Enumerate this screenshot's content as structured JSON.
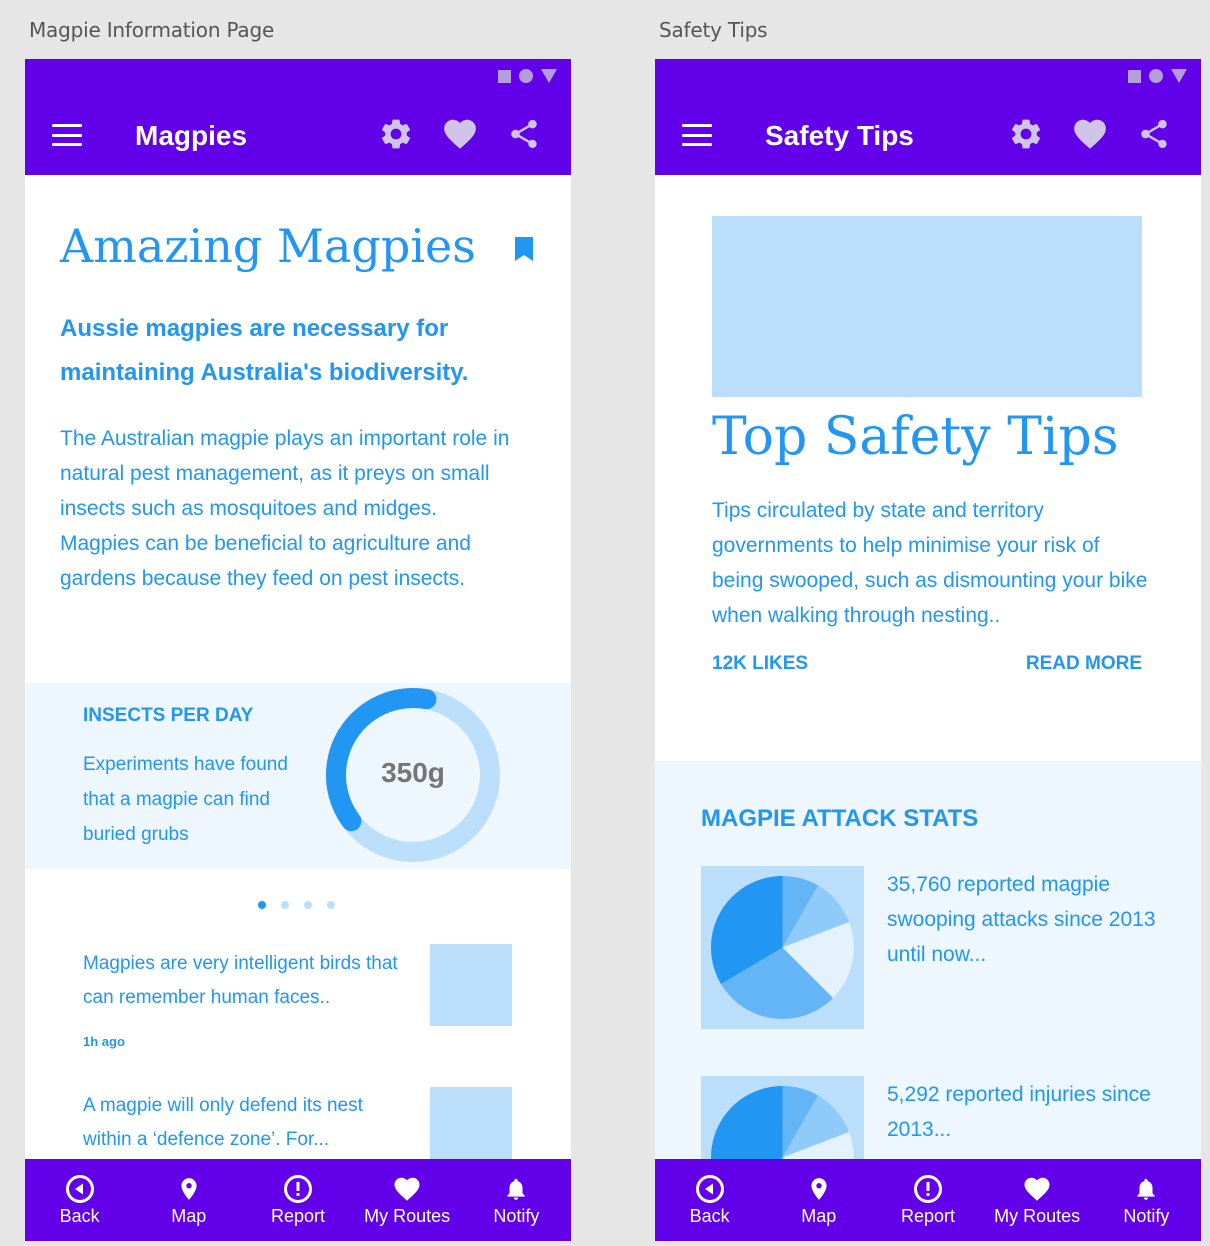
{
  "artboards": [
    {
      "label": "Magpie Information Page",
      "appbar": {
        "title": "Magpies"
      },
      "content": {
        "headline": "Amazing Magpies",
        "subhead": "Aussie magpies are necessary for maintaining Australia's biodiversity.",
        "body": "The Australian magpie plays an important role in natural pest management, as it preys on small insects such as mosquitoes and midges. Magpies can be beneficial to agriculture and gardens because they feed on pest insects.",
        "insects_panel": {
          "title": "INSECTS PER DAY",
          "text": "Experiments have found that a magpie can find buried grubs",
          "donut_value": "350g",
          "donut_fraction": 0.38
        },
        "carousel": {
          "total": 4,
          "active": 0
        },
        "news": [
          {
            "text": "Magpies are very intelligent birds that can remember human faces..",
            "time": "1h ago"
          },
          {
            "text": "A magpie will only defend its nest within a ‘defence zone’. For..."
          }
        ]
      }
    },
    {
      "label": "Safety Tips",
      "appbar": {
        "title": "Safety Tips"
      },
      "content": {
        "headline": "Top Safety Tips",
        "body": "Tips circulated by state and territory governments to help minimise your risk of being swooped, such as dismounting your bike when walking through nesting..",
        "likes": "12K LIKES",
        "read_more": "READ MORE",
        "stats": {
          "title": "MAGPIE ATTACK STATS",
          "items": [
            {
              "text": "35,760 reported magpie swooping attacks since 2013 until now..."
            },
            {
              "text": "5,292 reported injuries since 2013..."
            }
          ]
        }
      }
    }
  ],
  "bottom_nav": [
    "Back",
    "Map",
    "Report",
    "My Routes",
    "Notify"
  ],
  "icons": {
    "status": [
      "square-icon",
      "circle-icon",
      "triangle-icon"
    ],
    "appbar_actions": [
      "gear-icon",
      "heart-icon",
      "share-icon"
    ],
    "bottom_nav": [
      "back-circle-icon",
      "map-pin-icon",
      "alert-circle-icon",
      "heart-icon",
      "bell-icon"
    ]
  },
  "colors": {
    "primary": "#6200ea",
    "accent": "#2196f3",
    "light_accent": "#bbdefb",
    "panel": "#eef6fe",
    "appbar_icon": "#d1c4e9"
  }
}
